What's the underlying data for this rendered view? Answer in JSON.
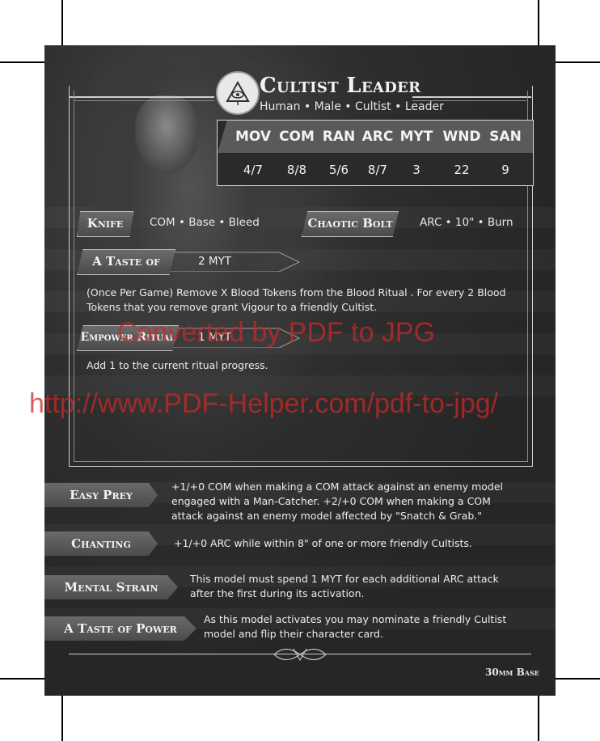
{
  "card": {
    "name": "Cultist Leader",
    "traits": "Human • Male • Cultist • Leader",
    "base": "30mm Base"
  },
  "stats": [
    {
      "label": "MOV",
      "value": "4/7"
    },
    {
      "label": "COM",
      "value": "8/8"
    },
    {
      "label": "RAN",
      "value": "5/6"
    },
    {
      "label": "ARC",
      "value": "8/7"
    },
    {
      "label": "MYT",
      "value": "3"
    },
    {
      "label": "WND",
      "value": "22"
    },
    {
      "label": "SAN",
      "value": "9"
    }
  ],
  "weapons": [
    {
      "name": "Knife",
      "traits": "COM • Base • Bleed"
    },
    {
      "name": "Chaotic Bolt",
      "traits": "ARC • 10\" • Burn"
    }
  ],
  "actions": [
    {
      "name": "A Taste of Life",
      "cost": "2 MYT",
      "text": "(Once Per Game) Remove X Blood Tokens from the Blood Ritual . For every 2 Blood Tokens that you remove grant Vigour to a friendly Cultist."
    },
    {
      "name": "Empower Ritual",
      "cost": "1 MYT",
      "text": "Add 1 to the current ritual progress."
    }
  ],
  "abilities": [
    {
      "name": "Easy Prey",
      "text": "+1/+0 COM when making a COM attack against an enemy model engaged with a Man-Catcher. +2/+0 COM when making a COM attack against an enemy model affected by \"Snatch & Grab.\""
    },
    {
      "name": "Chanting",
      "text": "+1/+0 ARC while within 8\" of  one or more friendly Cultists."
    },
    {
      "name": "Mental Strain",
      "text": "This model must spend 1 MYT for each additional ARC attack after the first during its activation."
    },
    {
      "name": "A Taste of Power",
      "text": "As this model activates you may nominate a friendly Cultist model and flip their character card."
    }
  ],
  "watermarks": {
    "line1": "Converted by PDF to JPG",
    "line2": "http://www.PDF-Helper.com/pdf-to-jpg/",
    "color": "#c82828"
  },
  "icons": {
    "faction_emblem": "eye-sigil-icon"
  }
}
